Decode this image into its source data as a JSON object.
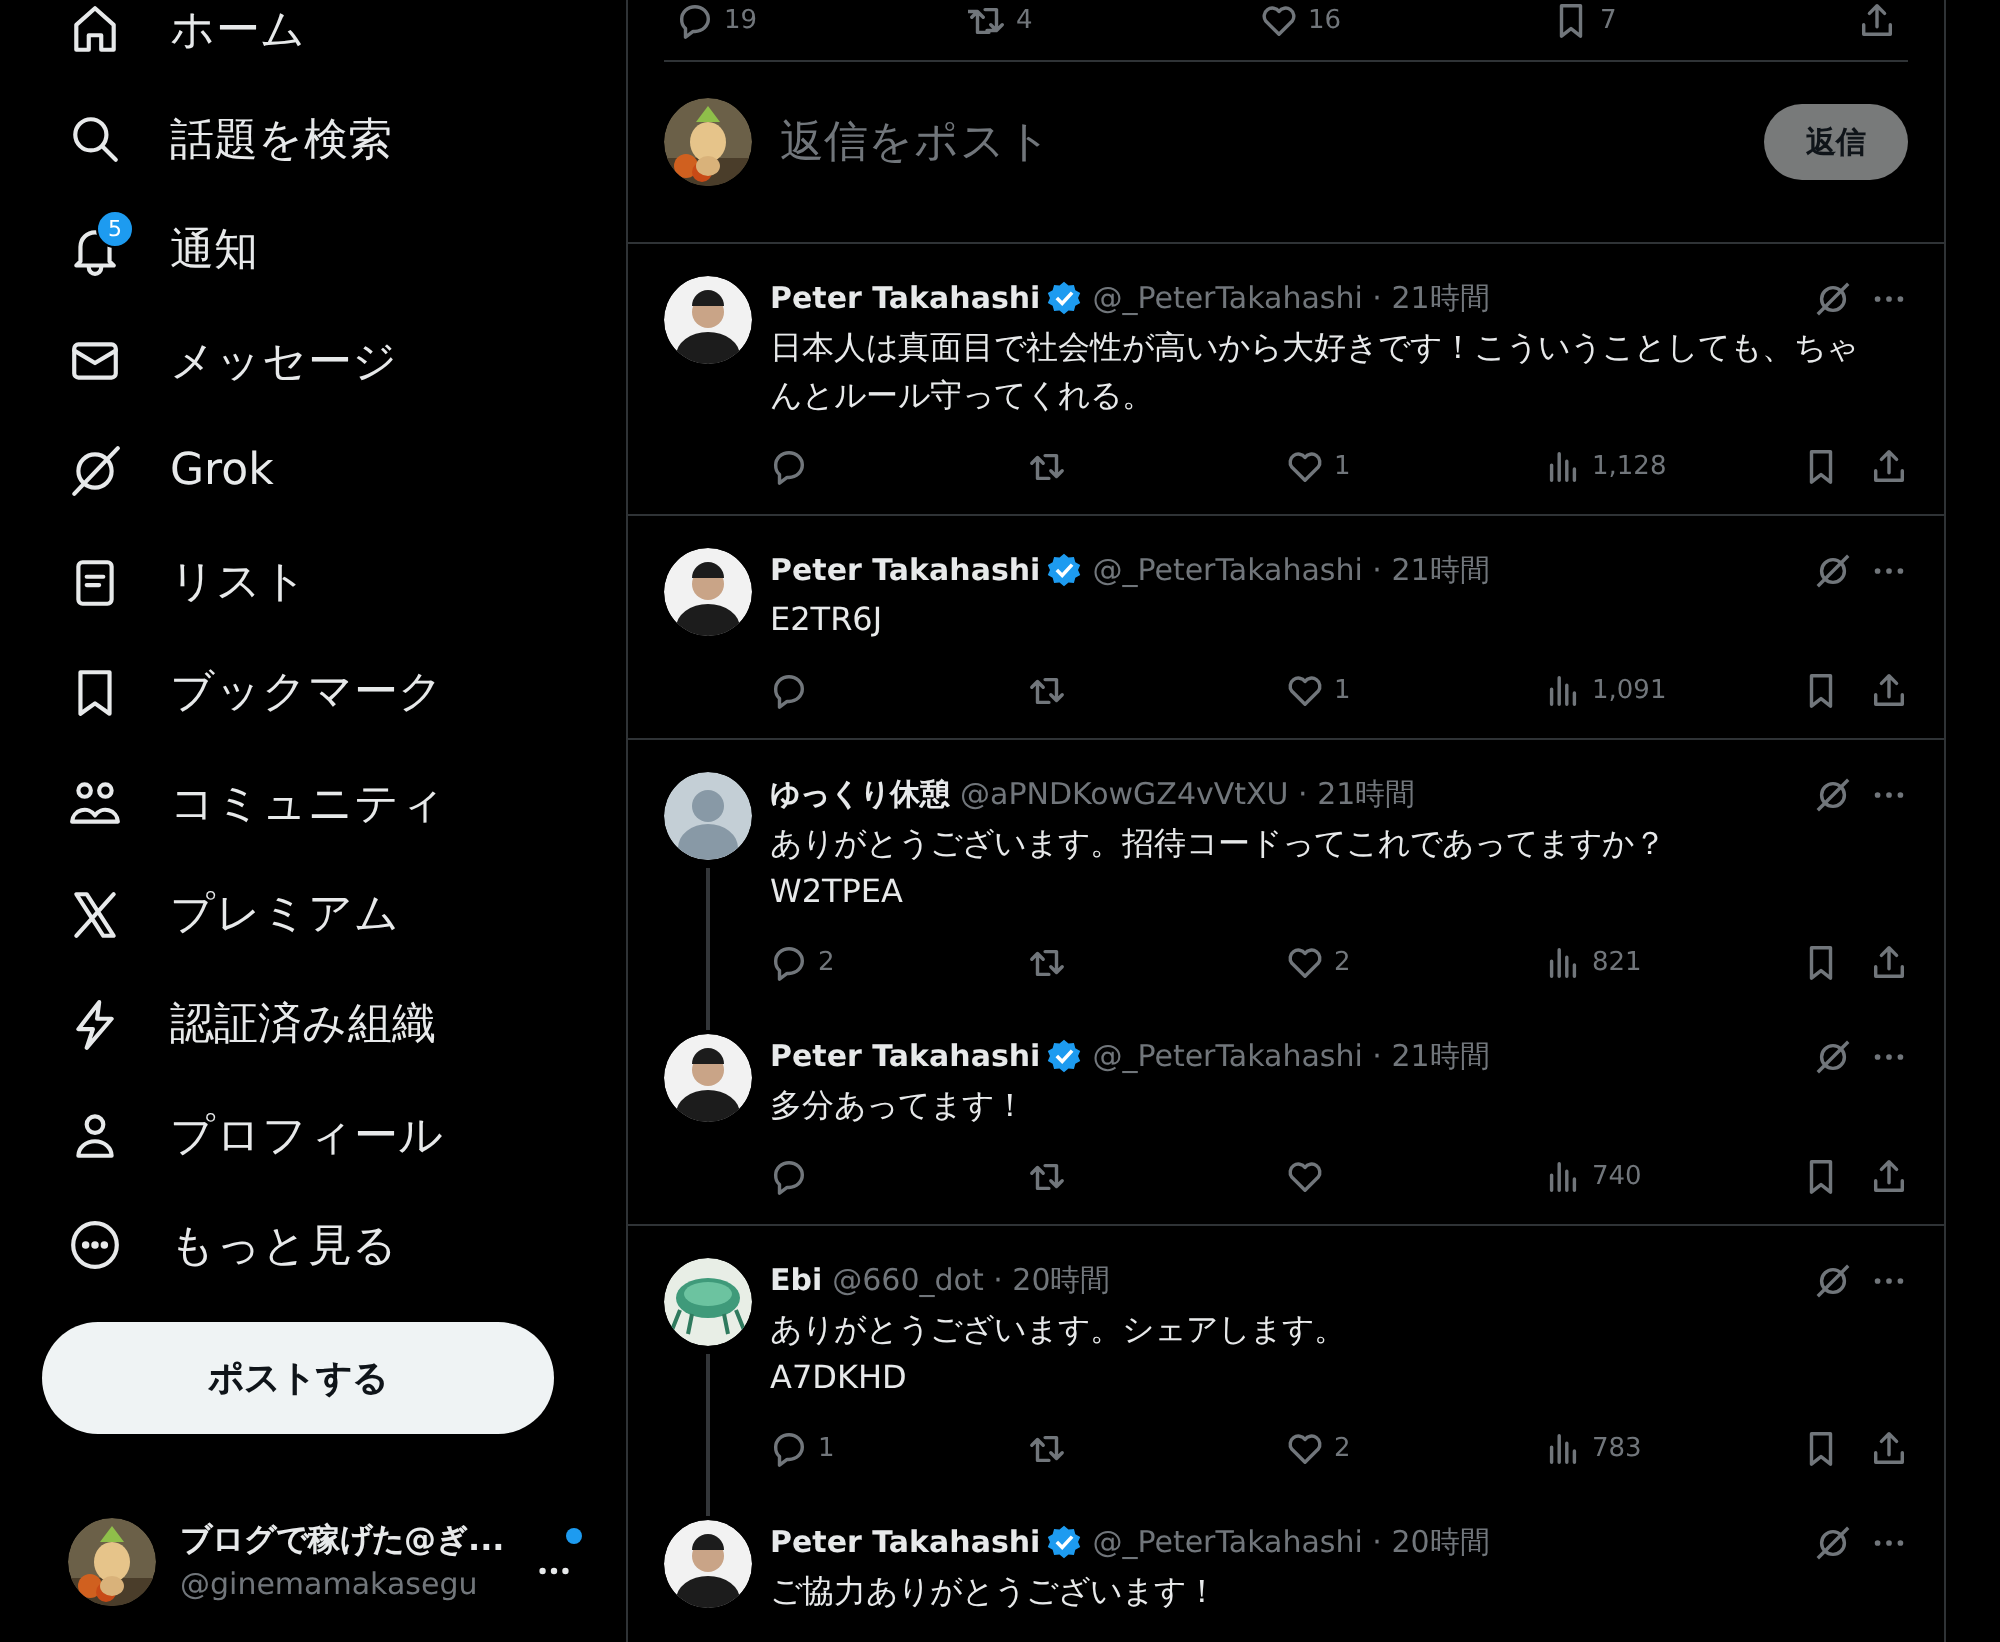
{
  "sidebar": {
    "items": [
      {
        "label": "ホーム"
      },
      {
        "label": "話題を検索"
      },
      {
        "label": "通知",
        "badge": "5"
      },
      {
        "label": "メッセージ"
      },
      {
        "label": "Grok"
      },
      {
        "label": "リスト"
      },
      {
        "label": "ブックマーク"
      },
      {
        "label": "コミュニティ"
      },
      {
        "label": "プレミアム"
      },
      {
        "label": "認証済み組織"
      },
      {
        "label": "プロフィール"
      },
      {
        "label": "もっと見る"
      }
    ],
    "post_button": "ポストする",
    "account": {
      "name": "ブログで稼げた@ぎ...",
      "handle": "@ginemamakasegu",
      "notification_dot": true
    }
  },
  "post_stats": {
    "replies": "19",
    "reposts": "4",
    "likes": "16",
    "bookmarks": "7"
  },
  "composer": {
    "placeholder": "返信をポスト",
    "button": "返信",
    "disabled": true
  },
  "replies": [
    {
      "kind": "person",
      "name": "Peter Takahashi",
      "verified": true,
      "meta": "@_PeterTakahashi · 21時間",
      "body": [
        "日本人は真面目で社会性が高いから大好きです！こういうことしても、ちゃんとルール守ってくれる。"
      ],
      "connected_below": false,
      "actions": {
        "likes": "1",
        "views": "1,128"
      }
    },
    {
      "kind": "person",
      "name": "Peter Takahashi",
      "verified": true,
      "meta": "@_PeterTakahashi · 21時間",
      "body": [
        "E2TR6J"
      ],
      "connected_below": false,
      "actions": {
        "likes": "1",
        "views": "1,091"
      }
    },
    {
      "kind": "default",
      "name": "ゆっくり休憩",
      "verified": false,
      "meta": "@aPNDKowGZ4vVtXU · 21時間",
      "body": [
        "ありがとうございます。招待コードってこれであってますか？",
        "W2TPEA"
      ],
      "connected_below": true,
      "actions": {
        "replies": "2",
        "likes": "2",
        "views": "821"
      }
    },
    {
      "kind": "person",
      "name": "Peter Takahashi",
      "verified": true,
      "meta": "@_PeterTakahashi · 21時間",
      "body": [
        "多分あってます！"
      ],
      "connected_below": false,
      "actions": {
        "views": "740"
      }
    },
    {
      "kind": "picture",
      "name": "Ebi",
      "verified": false,
      "meta": "@660_dot · 20時間",
      "body": [
        "ありがとうございます。シェアします。",
        "A7DKHD"
      ],
      "connected_below": true,
      "actions": {
        "replies": "1",
        "likes": "2",
        "views": "783"
      }
    },
    {
      "kind": "person",
      "name": "Peter Takahashi",
      "verified": true,
      "meta": "@_PeterTakahashi · 20時間",
      "body": [
        "ご協力ありがとうございます！"
      ],
      "connected_below": false
    }
  ]
}
